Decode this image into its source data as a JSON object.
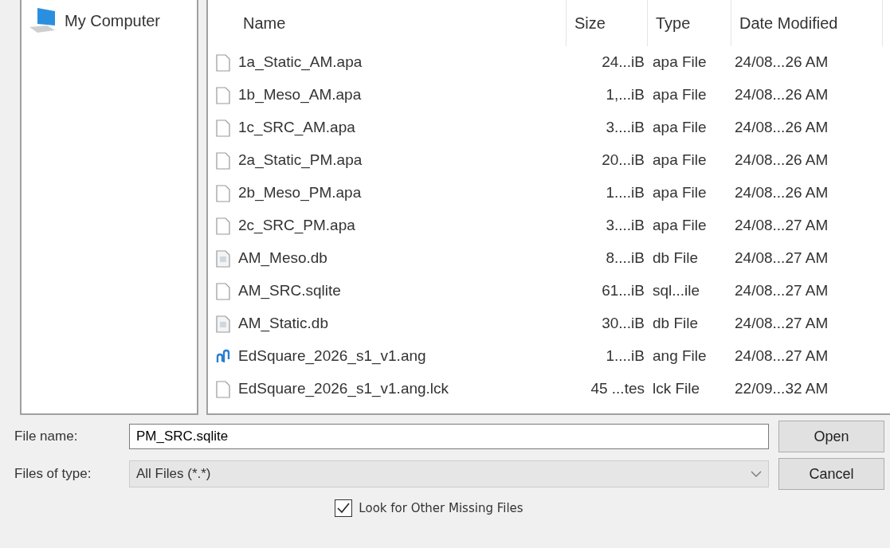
{
  "places": [
    {
      "label": "My Computer"
    }
  ],
  "file_list": {
    "columns": [
      "Name",
      "Size",
      "Type",
      "Date Modified"
    ],
    "rows": [
      {
        "kind": "blank",
        "name": "1a_Static_AM.apa",
        "size": "24...iB",
        "type": "apa File",
        "date": "24/08...26 AM"
      },
      {
        "kind": "blank",
        "name": "1b_Meso_AM.apa",
        "size": "1,...iB",
        "type": "apa File",
        "date": "24/08...26 AM"
      },
      {
        "kind": "blank",
        "name": "1c_SRC_AM.apa",
        "size": "3....iB",
        "type": "apa File",
        "date": "24/08...26 AM"
      },
      {
        "kind": "blank",
        "name": "2a_Static_PM.apa",
        "size": "20...iB",
        "type": "apa File",
        "date": "24/08...26 AM"
      },
      {
        "kind": "blank",
        "name": "2b_Meso_PM.apa",
        "size": "1....iB",
        "type": "apa File",
        "date": "24/08...26 AM"
      },
      {
        "kind": "blank",
        "name": "2c_SRC_PM.apa",
        "size": "3....iB",
        "type": "apa File",
        "date": "24/08...27 AM"
      },
      {
        "kind": "db",
        "name": "AM_Meso.db",
        "size": "8....iB",
        "type": "db File",
        "date": "24/08...27 AM"
      },
      {
        "kind": "blank",
        "name": "AM_SRC.sqlite",
        "size": "61...iB",
        "type": "sql...ile",
        "date": "24/08...27 AM"
      },
      {
        "kind": "db",
        "name": "AM_Static.db",
        "size": "30...iB",
        "type": "db File",
        "date": "24/08...27 AM"
      },
      {
        "kind": "ang",
        "name": "EdSquare_2026_s1_v1.ang",
        "size": "1....iB",
        "type": "ang File",
        "date": "24/08...27 AM"
      },
      {
        "kind": "blank",
        "name": "EdSquare_2026_s1_v1.ang.lck",
        "size": "45 ...tes",
        "type": "lck File",
        "date": "22/09...32 AM"
      }
    ]
  },
  "file_name": {
    "label": "File name:",
    "value": "PM_SRC.sqlite"
  },
  "file_type": {
    "label": "Files of type:",
    "value": "All Files (*.*)"
  },
  "buttons": [
    "Open",
    "Cancel"
  ],
  "option": {
    "label": "Look for Other Missing Files",
    "checked": true
  }
}
